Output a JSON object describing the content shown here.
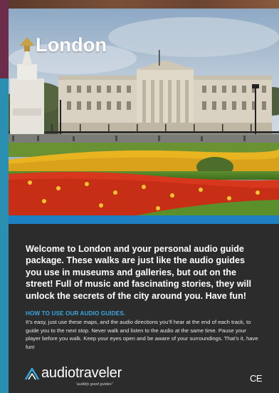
{
  "cover": {
    "title": "London"
  },
  "intro": {
    "text": "Welcome to London and your personal audio guide package. These walks are just like the audio guides you use in museums and galleries, but out on the street! Full of music and fascinating stories, they will unlock the secrets of the city around you. Have fun!"
  },
  "how_to": {
    "heading": "HOW TO USE OUR AUDIO GUIDES.",
    "body": "It’s easy, just use these maps, and the audio directions you’ll hear at the end of each track, to guide you to the next stop. Never walk and listen to the audio at the same time. Pause your player before you walk. Keep your eyes open and be aware of your surroundings. That’s it, have fun!"
  },
  "brand": {
    "name_part1": "audio",
    "name_part2": "traveler",
    "tagline": "“audibly good guides”"
  },
  "certification": {
    "mark": "CE"
  },
  "colors": {
    "accent_blue": "#1e7fc1",
    "heading_blue": "#38a7dd",
    "background": "#2c2c2c",
    "edge_teal": "#2a8fb0"
  }
}
